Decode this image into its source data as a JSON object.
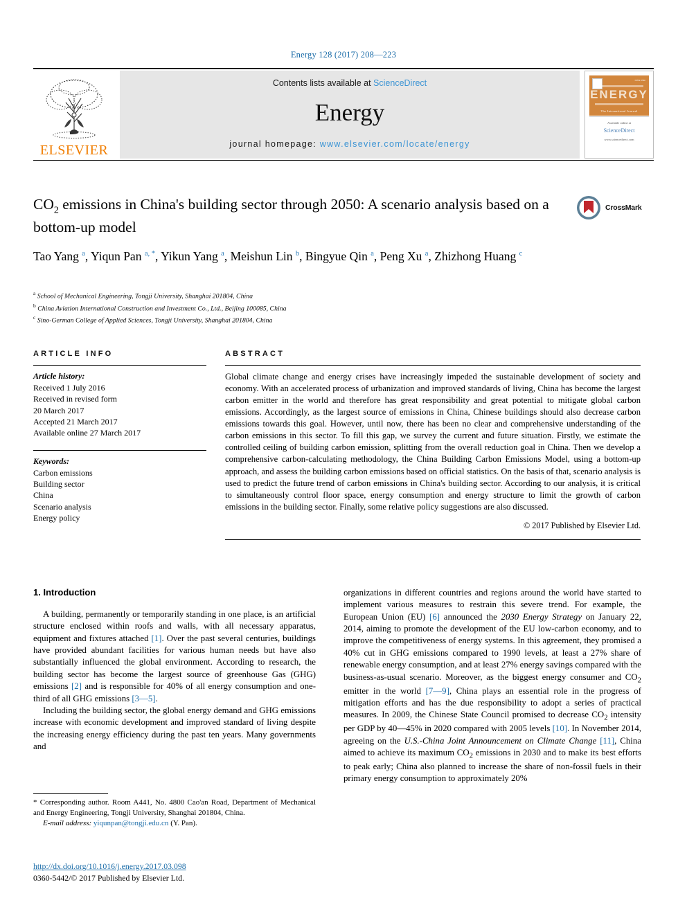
{
  "running_head": "Energy 128 (2017) 208—223",
  "masthead": {
    "publisher": "ELSEVIER",
    "contents_prefix": "Contents lists available at ",
    "contents_link": "ScienceDirect",
    "journal_name": "Energy",
    "homepage_prefix": "journal homepage: ",
    "homepage_url": "www.elsevier.com/locate/energy",
    "cover": {
      "title": "ENERGY",
      "subtitle": "The International Journal",
      "footer_line1": "Available online at",
      "footer_line2": "ScienceDirect",
      "footer_line3": "www.sciencedirect.com"
    }
  },
  "crossmark": {
    "label": "CrossMark"
  },
  "article": {
    "title_part1": "CO",
    "title_sub": "2",
    "title_part2": " emissions in China's building sector through 2050: A scenario analysis based on a bottom-up model",
    "authors": [
      {
        "name": "Tao Yang",
        "marks": "a"
      },
      {
        "name": "Yiqun Pan",
        "marks": "a, *"
      },
      {
        "name": "Yikun Yang",
        "marks": "a"
      },
      {
        "name": "Meishun Lin",
        "marks": "b"
      },
      {
        "name": "Bingyue Qin",
        "marks": "a"
      },
      {
        "name": "Peng Xu",
        "marks": "a"
      },
      {
        "name": "Zhizhong Huang",
        "marks": "c"
      }
    ],
    "affiliations": [
      {
        "mark": "a",
        "text": "School of Mechanical Engineering, Tongji University, Shanghai 201804, China"
      },
      {
        "mark": "b",
        "text": "China Aviation International Construction and Investment Co., Ltd., Beijing 100085, China"
      },
      {
        "mark": "c",
        "text": "Sino-German College of Applied Sciences, Tongji University, Shanghai 201804, China"
      }
    ]
  },
  "info": {
    "heading": "ARTICLE INFO",
    "history_label": "Article history:",
    "history": [
      "Received 1 July 2016",
      "Received in revised form",
      "20 March 2017",
      "Accepted 21 March 2017",
      "Available online 27 March 2017"
    ],
    "keywords_label": "Keywords:",
    "keywords": [
      "Carbon emissions",
      "Building sector",
      "China",
      "Scenario analysis",
      "Energy policy"
    ]
  },
  "abstract": {
    "heading": "ABSTRACT",
    "text": "Global climate change and energy crises have increasingly impeded the sustainable development of society and economy. With an accelerated process of urbanization and improved standards of living, China has become the largest carbon emitter in the world and therefore has great responsibility and great potential to mitigate global carbon emissions. Accordingly, as the largest source of emissions in China, Chinese buildings should also decrease carbon emissions towards this goal. However, until now, there has been no clear and comprehensive understanding of the carbon emissions in this sector. To fill this gap, we survey the current and future situation. Firstly, we estimate the controlled ceiling of building carbon emission, splitting from the overall reduction goal in China. Then we develop a comprehensive carbon-calculating methodology, the China Building Carbon Emissions Model, using a bottom-up approach, and assess the building carbon emissions based on official statistics. On the basis of that, scenario analysis is used to predict the future trend of carbon emissions in China's building sector. According to our analysis, it is critical to simultaneously control floor space, energy consumption and energy structure to limit the growth of carbon emissions in the building sector. Finally, some relative policy suggestions are also discussed.",
    "copyright": "© 2017 Published by Elsevier Ltd."
  },
  "body": {
    "section_number_title": "1. Introduction",
    "left_paragraph_1": "A building, permanently or temporarily standing in one place, is an artificial structure enclosed within roofs and walls, with all necessary apparatus, equipment and fixtures attached [1]. Over the past several centuries, buildings have provided abundant facilities for various human needs but have also substantially influenced the global environment. According to research, the building sector has become the largest source of greenhouse Gas (GHG) emissions [2] and is responsible for 40% of all energy consumption and one-third of all GHG emissions [3—5].",
    "left_paragraph_2": "Including the building sector, the global energy demand and GHG emissions increase with economic development and improved standard of living despite the increasing energy efficiency during the past ten years. Many governments and",
    "right_paragraph_1": "organizations in different countries and regions around the world have started to implement various measures to restrain this severe trend. For example, the European Union (EU) [6] announced the 2030 Energy Strategy on January 22, 2014, aiming to promote the development of the EU low-carbon economy, and to improve the competitiveness of energy systems. In this agreement, they promised a 40% cut in GHG emissions compared to 1990 levels, at least a 27% share of renewable energy consumption, and at least 27% energy savings compared with the business-as-usual scenario. Moreover, as the biggest energy consumer and CO2 emitter in the world [7—9], China plays an essential role in the progress of mitigation efforts and has the due responsibility to adopt a series of practical measures. In 2009, the Chinese State Council promised to decrease CO2 intensity per GDP by 40—45% in 2020 compared with 2005 levels [10]. In November 2014, agreeing on the U.S.-China Joint Announcement on Climate Change [11], China aimed to achieve its maximum CO2 emissions in 2030 and to make its best efforts to peak early; China also planned to increase the share of non-fossil fuels in their primary energy consumption to approximately 20%"
  },
  "footnotes": {
    "corresponding": "* Corresponding author. Room A441, No. 4800 Cao'an Road, Department of Mechanical and Energy Engineering, Tongji University, Shanghai 201804, China.",
    "email_label": "E-mail address:",
    "email": "yiqunpan@tongji.edu.cn",
    "email_suffix": "(Y. Pan).",
    "doi": "http://dx.doi.org/10.1016/j.energy.2017.03.098",
    "issn_line": "0360-5442/© 2017 Published by Elsevier Ltd."
  },
  "colors": {
    "link": "#1b6ca8",
    "sciencedirect": "#3c94d4",
    "elsevier_orange": "#f07d00",
    "band_gray": "#e6e6e6",
    "cover_orange": "#d2863c",
    "crossmark_red": "#c0272d",
    "crossmark_blue": "#5b7f96"
  }
}
